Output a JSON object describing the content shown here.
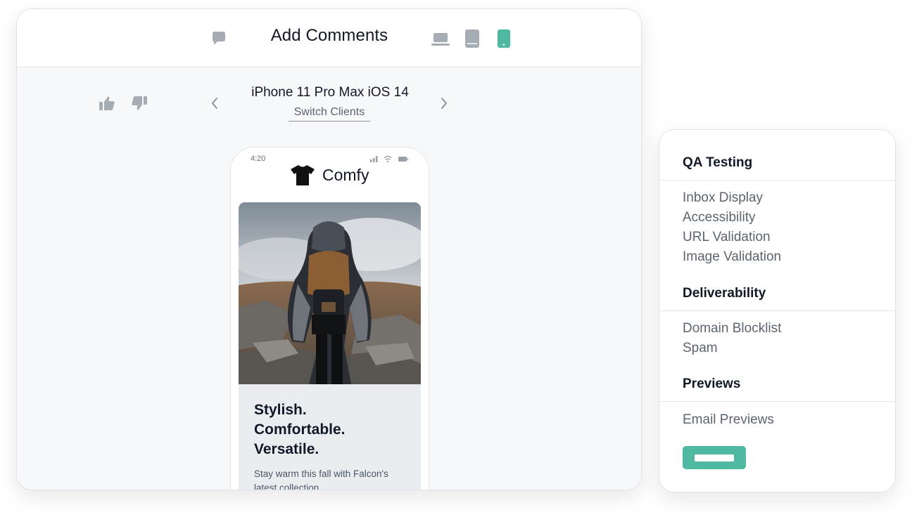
{
  "header": {
    "title": "Add Comments",
    "icons": [
      "comment-icon",
      "laptop-icon",
      "tablet-icon",
      "phone-icon"
    ],
    "active_device": "phone"
  },
  "toolbar": {
    "client_name": "iPhone 11 Pro Max iOS 14",
    "switch_label": "Switch Clients",
    "icons": [
      "thumbs-up-icon",
      "thumbs-down-icon",
      "chevron-left-icon",
      "chevron-right-icon"
    ]
  },
  "phone": {
    "time": "4:20",
    "brand": "Comfy",
    "headline": [
      "Stylish.",
      "Comfortable.",
      "Versatile."
    ],
    "body": "Stay warm this fall with Falcon's latest collection"
  },
  "qa_panel": {
    "sections": [
      {
        "title": "QA Testing",
        "items": [
          "Inbox Display",
          "Accessibility",
          "URL Validation",
          "Image Validation"
        ]
      },
      {
        "title": "Deliverability",
        "items": [
          "Domain Blocklist",
          "Spam"
        ]
      },
      {
        "title": "Previews",
        "items": [
          "Email Previews"
        ]
      }
    ]
  },
  "colors": {
    "accent": "#4fb8a0",
    "icon_gray": "#a6acb4",
    "text_dark": "#111827",
    "text_muted": "#5b6470"
  }
}
